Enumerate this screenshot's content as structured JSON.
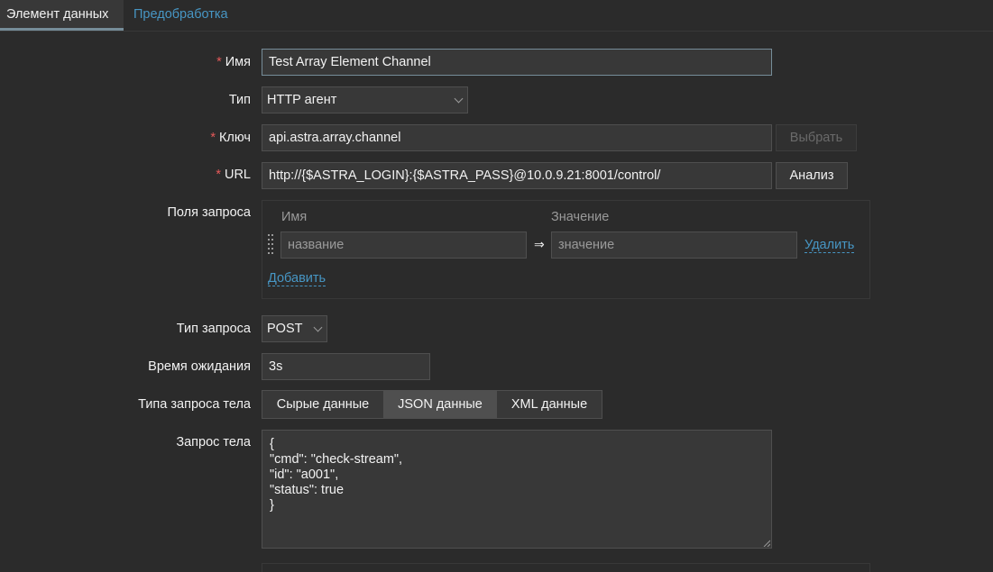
{
  "tabs": [
    {
      "label": "Элемент данных",
      "active": true
    },
    {
      "label": "Предобработка",
      "active": false
    }
  ],
  "form": {
    "name": {
      "label": "Имя",
      "required": true,
      "value": "Test Array Element Channel"
    },
    "type": {
      "label": "Тип",
      "value": "HTTP агент"
    },
    "key": {
      "label": "Ключ",
      "required": true,
      "value": "api.astra.array.channel",
      "button": "Выбрать"
    },
    "url": {
      "label": "URL",
      "required": true,
      "value": "http://{$ASTRA_LOGIN}:{$ASTRA_PASS}@10.0.9.21:8001/control/",
      "button": "Анализ"
    },
    "query_fields": {
      "label": "Поля запроса",
      "col_name": "Имя",
      "col_value": "Значение",
      "name_placeholder": "название",
      "value_placeholder": "значение",
      "arrow": "⇒",
      "remove": "Удалить",
      "add": "Добавить"
    },
    "request_type": {
      "label": "Тип запроса",
      "value": "POST"
    },
    "timeout": {
      "label": "Время ожидания",
      "value": "3s"
    },
    "body_type": {
      "label": "Типа запроса тела",
      "options": [
        "Сырые данные",
        "JSON данные",
        "XML данные"
      ],
      "selected": "JSON данные"
    },
    "body": {
      "label": "Запрос тела",
      "value": "{\n\"cmd\": \"check-stream\",\n\"id\": \"a001\",\n\"status\": true\n}"
    }
  },
  "colors": {
    "link": "#4796c4",
    "required": "#e45959",
    "background": "#2b2b2b",
    "field": "#383838"
  }
}
